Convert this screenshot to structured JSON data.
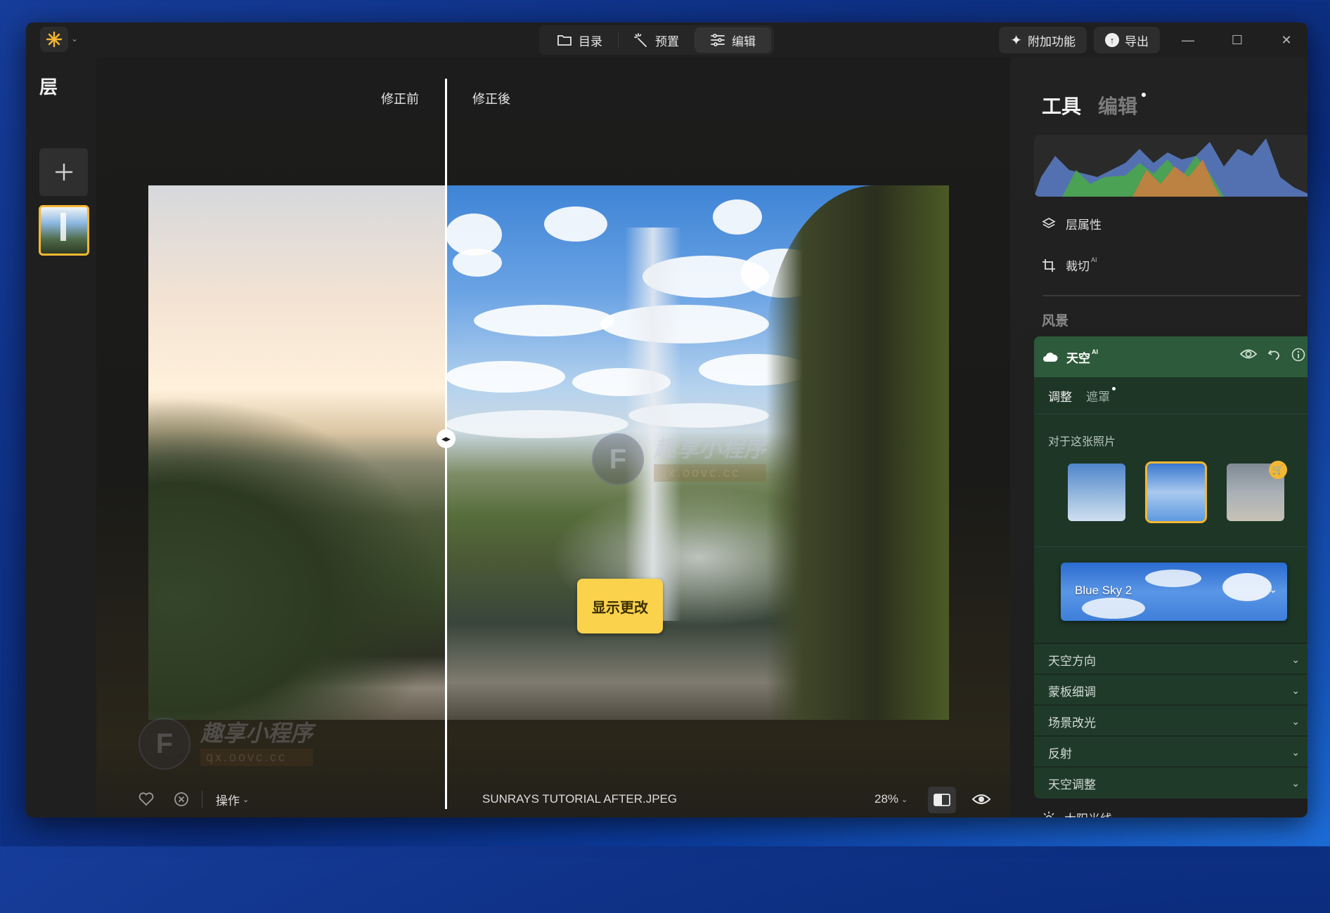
{
  "titlebar": {
    "tabs": [
      {
        "label": "目录",
        "icon": "folder-icon"
      },
      {
        "label": "预置",
        "icon": "magic-wand-icon"
      },
      {
        "label": "编辑",
        "icon": "sliders-icon"
      }
    ],
    "addons_label": "附加功能",
    "export_label": "导出"
  },
  "layers": {
    "title": "层"
  },
  "canvas": {
    "before_label": "修正前",
    "after_label": "修正後",
    "show_changes_label": "显示更改",
    "watermark_text": "趣享小程序",
    "watermark_sub": "qx.oovc.cc",
    "watermark_letter": "F"
  },
  "bottombar": {
    "actions_label": "操作",
    "filename": "SUNRAYS TUTORIAL AFTER.JPEG",
    "zoom": "28%"
  },
  "panel": {
    "tab_tools": "工具",
    "tab_edits": "编辑",
    "layer_props": "层属性",
    "crop": "裁切",
    "crop_ai": "AI",
    "section_landscape": "风景",
    "sky": {
      "title": "天空",
      "ai": "AI",
      "subtab_adjust": "调整",
      "subtab_mask": "遮罩",
      "for_this_photo": "对于这张照片",
      "selected_sky": "Blue Sky 2",
      "accordion": [
        "天空方向",
        "蒙板细调",
        "场景改光",
        "反射",
        "天空调整"
      ]
    },
    "sunrays": "太阳光线"
  },
  "colors": {
    "accent": "#f3b733",
    "sky_card_header": "#2c5a3a",
    "show_changes_bg": "#fbd24c"
  }
}
